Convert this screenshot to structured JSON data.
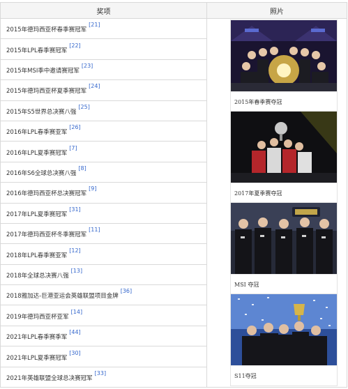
{
  "table": {
    "headers": [
      "奖项",
      "照片"
    ],
    "rows": [
      {
        "award": "2015年德玛西亚杯春季赛冠军",
        "ref": "[21]"
      },
      {
        "award": "2015年LPL春季赛冠军",
        "ref": "[22]"
      },
      {
        "award": "2015年MSI季中邀请赛冠军",
        "ref": "[23]"
      },
      {
        "award": "2015年德玛西亚杯夏季赛冠军",
        "ref": "[24]"
      },
      {
        "award": "2015年S5世界总决赛八强",
        "ref": "[25]"
      },
      {
        "award": "2016年LPL春季赛亚军",
        "ref": "[26]"
      },
      {
        "award": "2016年LPL夏季赛冠军",
        "ref": "[7]"
      },
      {
        "award": "2016年S6全球总决赛八强",
        "ref": "[8]"
      },
      {
        "award": "2016年德玛西亚杯总决赛冠军",
        "ref": "[9]"
      },
      {
        "award": "2017年LPL夏季赛冠军",
        "ref": "[31]"
      },
      {
        "award": "2017年德玛西亚杯冬季赛冠军",
        "ref": "[11]"
      },
      {
        "award": "2018年LPL春季赛亚军",
        "ref": "[12]"
      },
      {
        "award": "2018年全球总决赛八强",
        "ref": "[13]"
      },
      {
        "award": "2018雅加达-巨港亚运会英雄联盟项目金牌",
        "ref": "[36]"
      },
      {
        "award": "2019年德玛西亚杯亚军",
        "ref": "[14]"
      },
      {
        "award": "2021年LPL春季赛季军",
        "ref": "[44]"
      },
      {
        "award": "2021年LPL夏季赛冠军",
        "ref": "[30]"
      },
      {
        "award": "2021年英雄联盟全球总决赛冠军",
        "ref": "[33]"
      }
    ]
  },
  "photos": [
    {
      "caption": "2015年春季赛夺冠",
      "icon": "team-celebration-photo"
    },
    {
      "caption": "2017年夏季赛夺冠",
      "icon": "trophy-lift-photo"
    },
    {
      "caption": "MSI 夺冠",
      "icon": "team-portrait-photo"
    },
    {
      "caption": "S11夺冠",
      "icon": "confetti-trophy-photo"
    }
  ]
}
